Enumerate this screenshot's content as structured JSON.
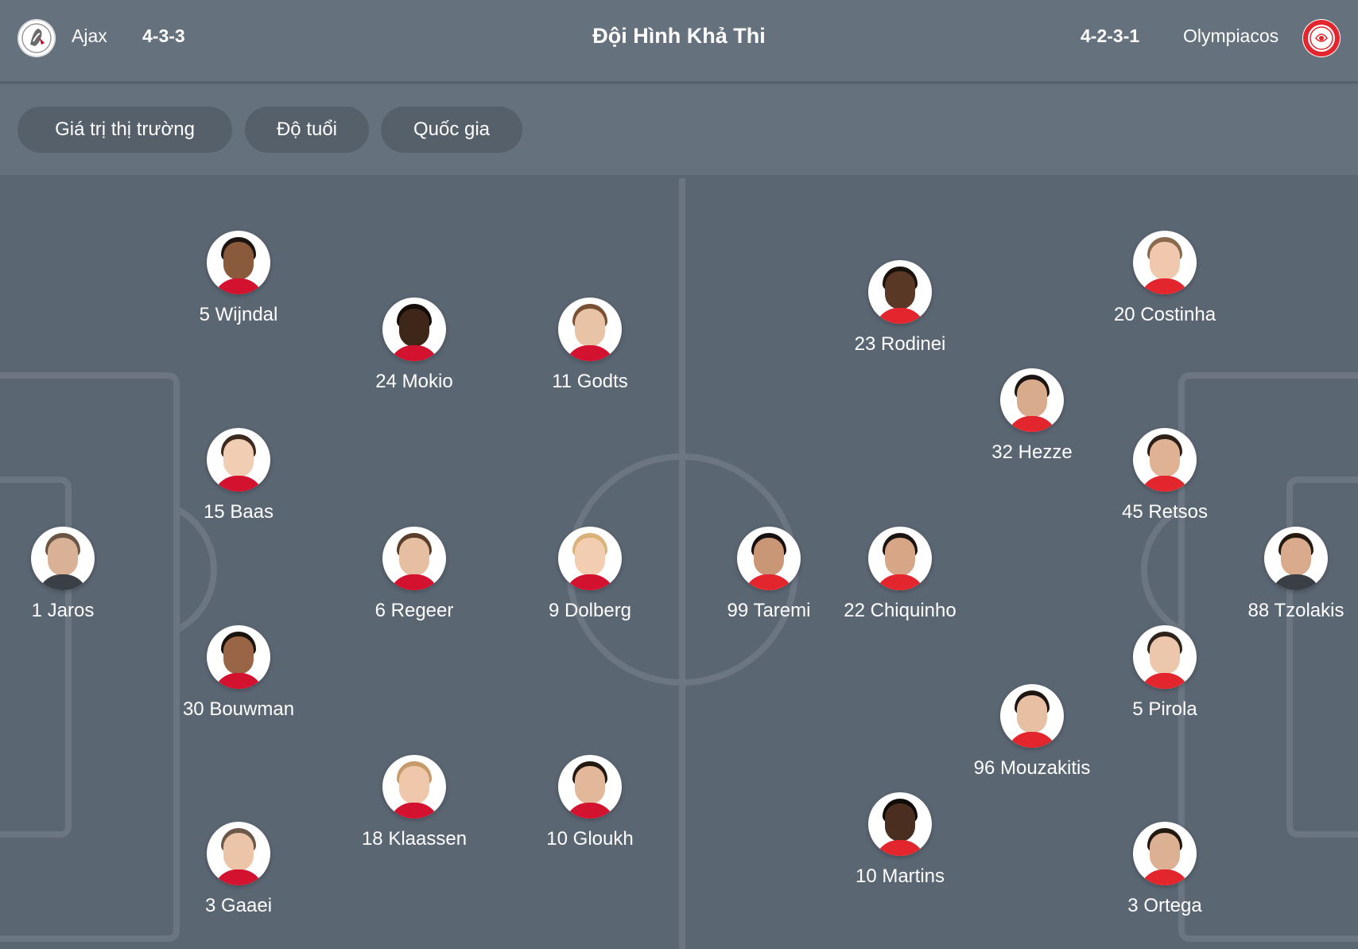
{
  "header": {
    "title": "Đội Hình Khả Thi",
    "home": {
      "name": "Ajax",
      "formation": "4-3-3",
      "logo": "ajax-crest-icon"
    },
    "away": {
      "name": "Olympiacos",
      "formation": "4-2-3-1",
      "logo": "olympiacos-crest-icon"
    }
  },
  "filters": [
    "Giá trị thị trường",
    "Độ tuổi",
    "Quốc gia"
  ],
  "colors": {
    "background": "#5b6673",
    "header": "#66717e",
    "chip": "#56606b",
    "lines": "#6c7682",
    "text": "#ffffff"
  },
  "home_players": [
    {
      "label": "5 Wijndal",
      "skin": "#8a5a3c",
      "hair": "#1c1410"
    },
    {
      "label": "24 Mokio",
      "skin": "#3e2618",
      "hair": "#140c08"
    },
    {
      "label": "11 Godts",
      "skin": "#e8c3a6",
      "hair": "#7a5034"
    },
    {
      "label": "15 Baas",
      "skin": "#f0cdb3",
      "hair": "#3c2a1e"
    },
    {
      "label": "1 Jaros",
      "skin": "#d9b197",
      "hair": "#6b5645"
    },
    {
      "label": "6 Regeer",
      "skin": "#e6bfa3",
      "hair": "#5a3e2c"
    },
    {
      "label": "9 Dolberg",
      "skin": "#f2cdb1",
      "hair": "#d9b27a"
    },
    {
      "label": "30 Bouwman",
      "skin": "#9a6446",
      "hair": "#1a120c"
    },
    {
      "label": "18 Klaassen",
      "skin": "#efc7ab",
      "hair": "#c79a6a"
    },
    {
      "label": "10 Gloukh",
      "skin": "#e3b79a",
      "hair": "#241812"
    },
    {
      "label": "3 Gaaei",
      "skin": "#ecc5a9",
      "hair": "#6b5848"
    }
  ],
  "away_players": [
    {
      "label": "23 Rodinei",
      "skin": "#5a3826",
      "hair": "#1a120c"
    },
    {
      "label": "20 Costinha",
      "skin": "#f0c8ad",
      "hair": "#8a6a4e"
    },
    {
      "label": "32 Hezze",
      "skin": "#d8ab8c",
      "hair": "#1c1410"
    },
    {
      "label": "45 Retsos",
      "skin": "#dfb293",
      "hair": "#2c2018"
    },
    {
      "label": "99 Taremi",
      "skin": "#c99676",
      "hair": "#161010"
    },
    {
      "label": "22 Chiquinho",
      "skin": "#d6a687",
      "hair": "#1c1410"
    },
    {
      "label": "88 Tzolakis",
      "skin": "#d9ab8c",
      "hair": "#241a12"
    },
    {
      "label": "5 Pirola",
      "skin": "#ecc7ab",
      "hair": "#2e241c"
    },
    {
      "label": "96 Mouzakitis",
      "skin": "#e7c0a3",
      "hair": "#1e1612"
    },
    {
      "label": "10 Martins",
      "skin": "#4a2e20",
      "hair": "#120c08"
    },
    {
      "label": "3 Ortega",
      "skin": "#dcb093",
      "hair": "#221810"
    }
  ]
}
